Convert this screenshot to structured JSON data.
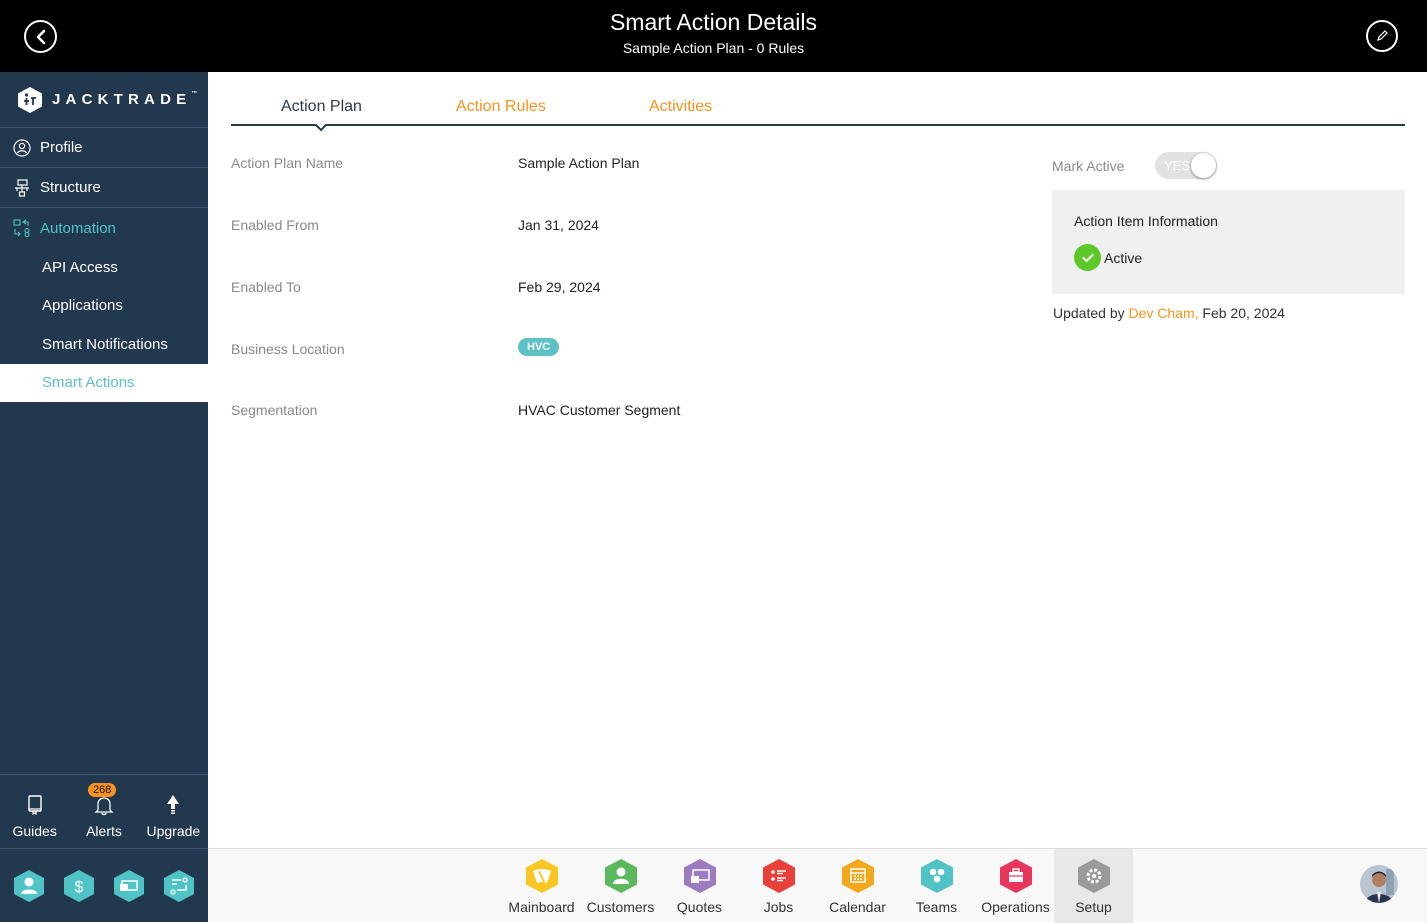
{
  "header": {
    "title": "Smart Action Details",
    "subtitle": "Sample Action Plan - 0 Rules",
    "back_icon": "chevron-left-circle-icon",
    "edit_icon": "pencil-circle-icon"
  },
  "sidebar": {
    "brand": "JACKTRADE",
    "brand_tm": "™",
    "items": [
      {
        "label": "Profile",
        "icon": "user-circle-icon"
      },
      {
        "label": "Structure",
        "icon": "hierarchy-icon"
      },
      {
        "label": "Automation",
        "icon": "automation-icon",
        "active": true
      }
    ],
    "sub_items": [
      {
        "label": "API Access"
      },
      {
        "label": "Applications"
      },
      {
        "label": "Smart Notifications"
      },
      {
        "label": "Smart Actions",
        "selected": true
      }
    ],
    "utilities": [
      {
        "label": "Guides",
        "icon": "book-icon"
      },
      {
        "label": "Alerts",
        "icon": "bell-icon",
        "badge": "268"
      },
      {
        "label": "Upgrade",
        "icon": "arrow-up-icon"
      }
    ],
    "quick_icons": [
      "user-hex-icon",
      "dollar-hex-icon",
      "money-hex-icon",
      "workflow-hex-icon"
    ]
  },
  "tabs": [
    {
      "label": "Action Plan",
      "active": true
    },
    {
      "label": "Action Rules"
    },
    {
      "label": "Activities"
    }
  ],
  "details": {
    "fields": [
      {
        "label": "Action Plan Name",
        "value": "Sample Action Plan"
      },
      {
        "label": "Enabled From",
        "value": "Jan 31, 2024"
      },
      {
        "label": "Enabled To",
        "value": "Feb 29, 2024"
      },
      {
        "label": "Business Location",
        "chip": "HVC"
      },
      {
        "label": "Segmentation",
        "value": "HVAC Customer Segment"
      }
    ]
  },
  "status_panel": {
    "mark_active_label": "Mark Active",
    "toggle_text": "YES",
    "toggle_on": true,
    "info_title": "Action Item Information",
    "status": "Active",
    "updated_prefix": "Updated by",
    "updated_by": "Dev Cham,",
    "updated_date": "Feb 20, 2024"
  },
  "dock": {
    "apps": [
      {
        "label": "Mainboard",
        "color": "#f9c623"
      },
      {
        "label": "Customers",
        "color": "#5cb85c"
      },
      {
        "label": "Quotes",
        "color": "#9b7cc0"
      },
      {
        "label": "Jobs",
        "color": "#e8413b"
      },
      {
        "label": "Calendar",
        "color": "#f4a81d"
      },
      {
        "label": "Teams",
        "color": "#4fc3c6"
      },
      {
        "label": "Operations",
        "color": "#e8365a"
      },
      {
        "label": "Setup",
        "color": "#9a9a9a",
        "selected": true
      }
    ]
  },
  "colors": {
    "accent_orange": "#f7931e",
    "teal": "#4fc3c6",
    "sidebar_bg": "#22384e",
    "active_green": "#5cc929"
  }
}
